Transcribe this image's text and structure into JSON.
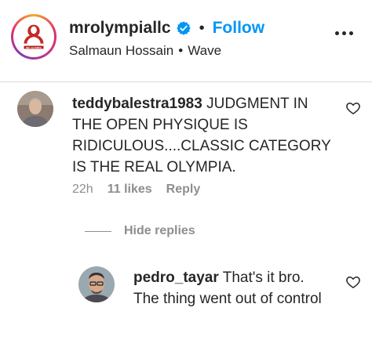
{
  "post_header": {
    "username": "mrolympiallc",
    "separator": "•",
    "follow_label": "Follow",
    "audio_artist": "Salmaun Hossain",
    "audio_separator": "•",
    "audio_track": "Wave",
    "avatar_logo_text": "MR. OLYMPIA"
  },
  "comments": [
    {
      "username": "teddybalestra1983",
      "text": "JUDGMENT IN THE OPEN PHYSIQUE IS RIDICULOUS....CLASSIC CATEGORY IS THE REAL OLYMPIA.",
      "time": "22h",
      "likes": "11 likes",
      "reply_label": "Reply",
      "hide_replies_label": "Hide replies"
    },
    {
      "username": "pedro_tayar",
      "text": "That's it bro. The thing went out of control"
    }
  ],
  "icons": {
    "verified": "verified-badge-icon",
    "more": "more-options-icon",
    "like": "heart-icon"
  },
  "colors": {
    "accent": "#0095f6",
    "text": "#262626",
    "muted": "#8e8e8e",
    "divider": "#dbdbdb"
  }
}
